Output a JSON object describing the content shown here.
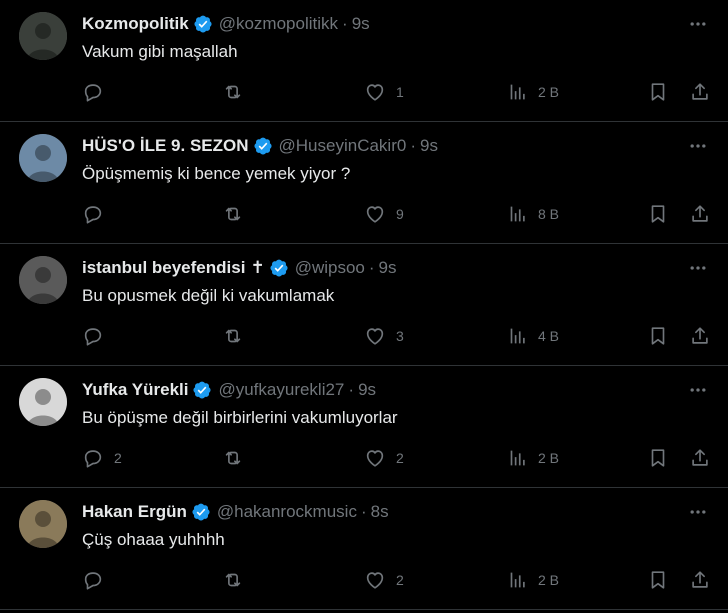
{
  "tweets": [
    {
      "name": "Kozmopolitik",
      "handle": "@kozmopolitikk",
      "time": "9s",
      "text": "Vakum gibi maşallah",
      "replies": "",
      "likes": "1",
      "views": "2 B",
      "has_cross": false,
      "avatar_color": "#3a3f3a"
    },
    {
      "name": "HÜS'O İLE 9. SEZON",
      "handle": "@HuseyinCakir0",
      "time": "9s",
      "text": "Öpüşmemiş ki bence yemek yiyor ?",
      "replies": "",
      "likes": "9",
      "views": "8 B",
      "has_cross": false,
      "avatar_color": "#6d8aa6"
    },
    {
      "name": "istanbul beyefendisi",
      "cross": "✝",
      "handle": "@wipsoo",
      "time": "9s",
      "text": "Bu opusmek değil ki vakumlamak",
      "replies": "",
      "likes": "3",
      "views": "4 B",
      "has_cross": true,
      "avatar_color": "#5a5a5a"
    },
    {
      "name": "Yufka Yürekli",
      "handle": "@yufkayurekli27",
      "time": "9s",
      "text": "Bu öpüşme değil birbirlerini vakumluyorlar",
      "replies": "2",
      "likes": "2",
      "views": "2 B",
      "has_cross": false,
      "avatar_color": "#d8d8d8"
    },
    {
      "name": "Hakan Ergün",
      "handle": "@hakanrockmusic",
      "time": "8s",
      "text": "Çüş ohaaa yuhhhh",
      "replies": "",
      "likes": "2",
      "views": "2 B",
      "has_cross": false,
      "avatar_color": "#8a7a5a"
    }
  ],
  "separator": "·",
  "colors": {
    "background": "#000000",
    "text": "#e7e9ea",
    "muted": "#71767b",
    "verified": "#1d9bf0",
    "border": "#2f3336"
  },
  "icons": [
    "more-icon",
    "verified-badge-icon",
    "reply-icon",
    "retweet-icon",
    "like-icon",
    "views-icon",
    "bookmark-icon",
    "share-icon"
  ]
}
